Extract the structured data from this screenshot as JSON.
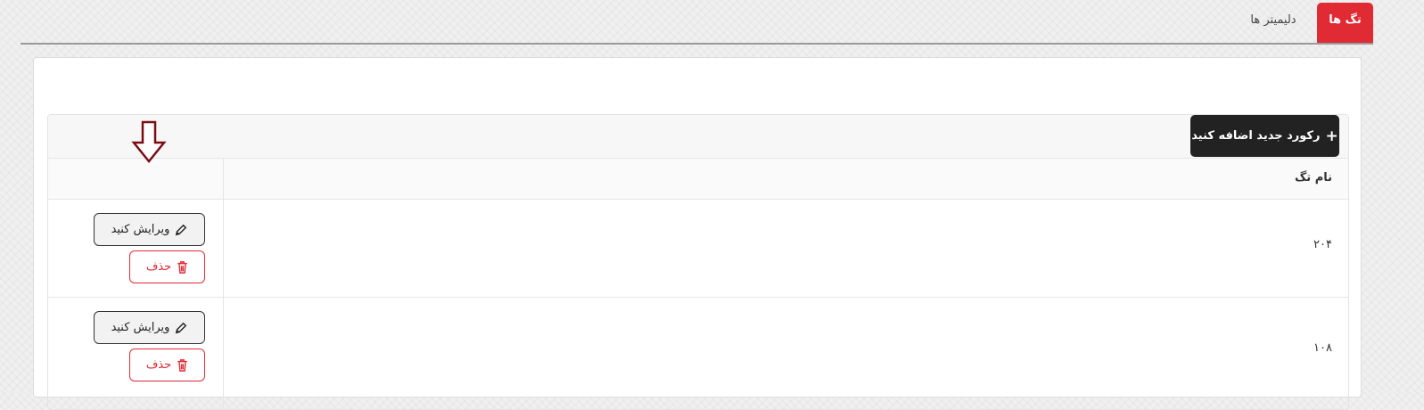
{
  "tabs": [
    {
      "label": "تگ ها",
      "active": true
    },
    {
      "label": "دلیمیتر ها",
      "active": false
    }
  ],
  "toolbar": {
    "add_label": "رکورد جدید اضافه کنید"
  },
  "table": {
    "header": "نام تگ",
    "rows": [
      {
        "value": "۲۰۴",
        "edit_label": "ویرایش کنید",
        "delete_label": "حذف"
      },
      {
        "value": "۱۰۸",
        "edit_label": "ویرایش کنید",
        "delete_label": "حذف"
      }
    ]
  },
  "colors": {
    "accent": "#e02b35",
    "dark": "#222222"
  },
  "icons": [
    "plus-icon",
    "pencil-icon",
    "trash-icon",
    "down-arrow-icon"
  ]
}
